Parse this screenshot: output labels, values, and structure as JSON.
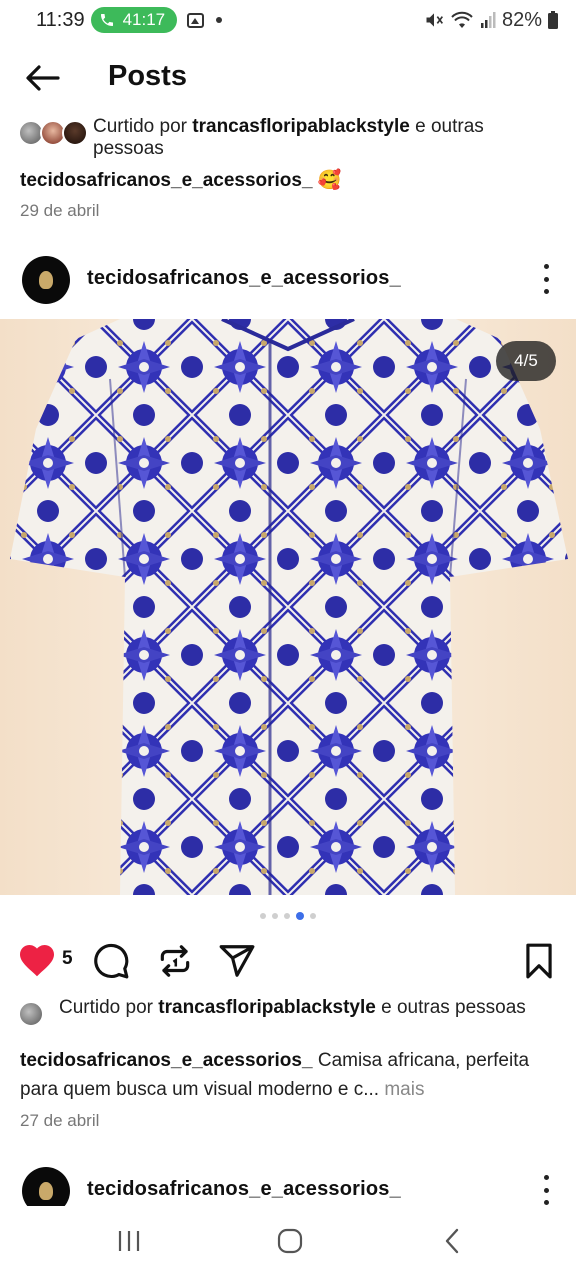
{
  "status_bar": {
    "time": "11:39",
    "call_duration": "41:17",
    "battery": "82%"
  },
  "header": {
    "title": "Posts"
  },
  "previous_post": {
    "liked_by_prefix": "Curtido por",
    "liked_by_user": "trancasfloripablackstyle",
    "liked_by_suffix": "e outras pessoas",
    "caption_user": "tecidosafricanos_e_acessorios_",
    "caption_emoji": "🥰",
    "date": "29 de abril"
  },
  "post": {
    "username": "tecidosafricanos_e_acessorios_",
    "image_counter": "4/5",
    "carousel_total": 5,
    "carousel_active_index": 3,
    "likes_count": "5",
    "liked_by_prefix": "Curtido por",
    "liked_by_user": "trancasfloripablackstyle",
    "liked_by_suffix": "e outras pessoas",
    "caption_user": "tecidosafricanos_e_acessorios_",
    "caption_text": "Camisa africana, perfeita para quem busca um visual moderno e c...",
    "caption_more": "mais",
    "date": "27 de abril",
    "image_subject": "short-sleeve shirt with blue and white geometric floral print",
    "shirt_colors": {
      "primary": "#2f2fb0",
      "secondary": "#f4f1ec",
      "background": "#f6e6d2"
    }
  },
  "next_post": {
    "username": "tecidosafricanos_e_acessorios_"
  },
  "colors": {
    "like_red": "#ed2244",
    "call_green": "#3dba5a",
    "active_dot": "#3d6ee8"
  },
  "icons": [
    "back-arrow-icon",
    "more-vertical-icon",
    "heart-filled-icon",
    "comment-icon",
    "repost-icon",
    "share-icon",
    "bookmark-icon",
    "recents-icon",
    "home-icon",
    "back-nav-icon"
  ]
}
